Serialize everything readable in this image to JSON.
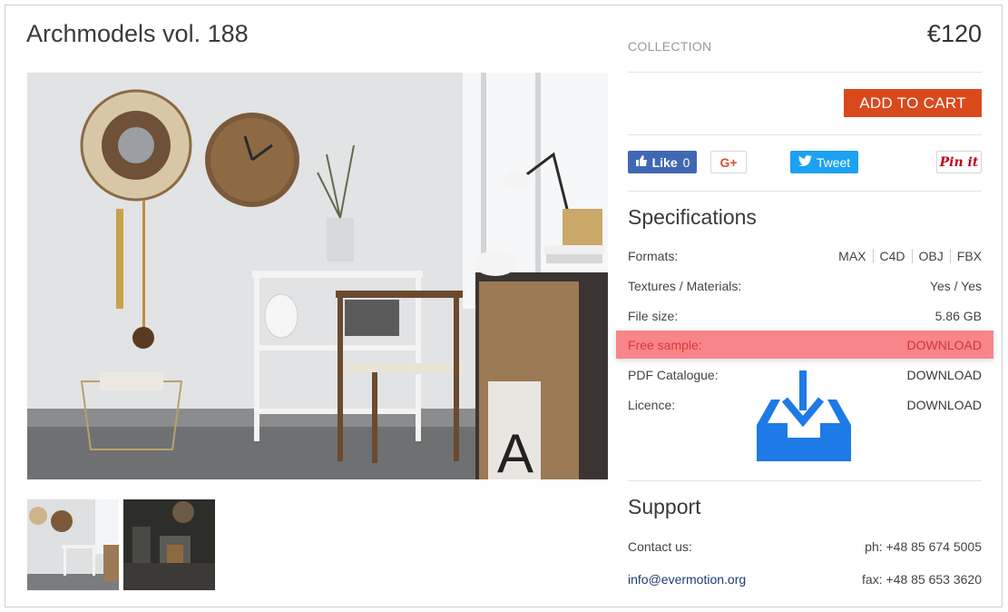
{
  "product": {
    "title": "Archmodels vol. 188",
    "collection_label": "COLLECTION",
    "price": "€120",
    "add_to_cart_label": "ADD TO CART"
  },
  "social": {
    "fb_like_label": "Like",
    "fb_like_count": "0",
    "gplus_label": "G+",
    "tweet_label": "Tweet",
    "pinit_label": "Pin it"
  },
  "specifications": {
    "title": "Specifications",
    "formats_label": "Formats:",
    "formats": [
      "MAX",
      "C4D",
      "OBJ",
      "FBX"
    ],
    "textures_label": "Textures / Materials:",
    "textures_value": "Yes / Yes",
    "filesize_label": "File size:",
    "filesize_value": "5.86 GB",
    "free_sample_label": "Free sample:",
    "free_sample_action": "DOWNLOAD",
    "pdf_label": "PDF Catalogue:",
    "pdf_action": "DOWNLOAD",
    "licence_label": "Licence:",
    "licence_action": "DOWNLOAD"
  },
  "support": {
    "title": "Support",
    "contact_label": "Contact us:",
    "phone": "ph: +48 85 674 5005",
    "email": "info@evermotion.org",
    "fax": "fax: +48 85 653 3620"
  },
  "colors": {
    "accent_button": "#d9491c",
    "highlight": "#f8858a",
    "download_icon": "#1e7ae6"
  },
  "icons": {
    "download_tray": "download-tray-icon"
  }
}
